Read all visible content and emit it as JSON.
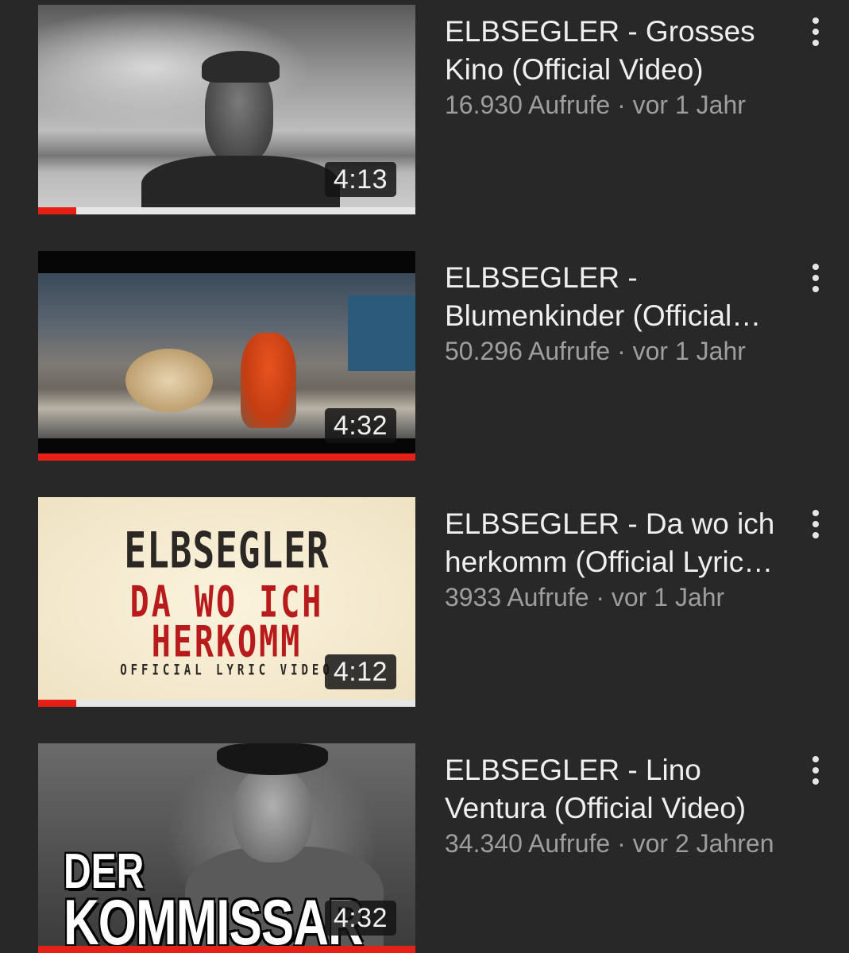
{
  "videos": [
    {
      "title": "ELBSEGLER - Grosses Kino (Official Video)",
      "meta": "16.930 Aufrufe · vor 1 Jahr",
      "duration": "4:13",
      "watched_fraction": 0.1
    },
    {
      "title": "ELBSEGLER - Blumenkinder (Official Video)",
      "meta": "50.296 Aufrufe · vor 1 Jahr",
      "duration": "4:32",
      "watched_fraction": 1.0
    },
    {
      "title": "ELBSEGLER - Da wo ich herkomm (Official Lyric Video)",
      "meta": "3933 Aufrufe · vor 1 Jahr",
      "duration": "4:12",
      "watched_fraction": 0.1,
      "thumbnail_text": [
        "ELBSEGLER",
        "DA WO ICH",
        "HERKOMM",
        "OFFICIAL LYRIC VIDEO"
      ]
    },
    {
      "title": "ELBSEGLER - Lino Ventura (Official Video)",
      "meta": "34.340 Aufrufe · vor 2 Jahren",
      "duration": "4:32",
      "watched_fraction": 1.0,
      "thumbnail_text": [
        "DER",
        "KOMMISSAR"
      ]
    }
  ],
  "colors": {
    "background": "#282828",
    "progress": "#e52117",
    "title": "#efefef",
    "meta": "#9e9e9e"
  },
  "icons": {
    "menu": "more-vert-icon"
  }
}
